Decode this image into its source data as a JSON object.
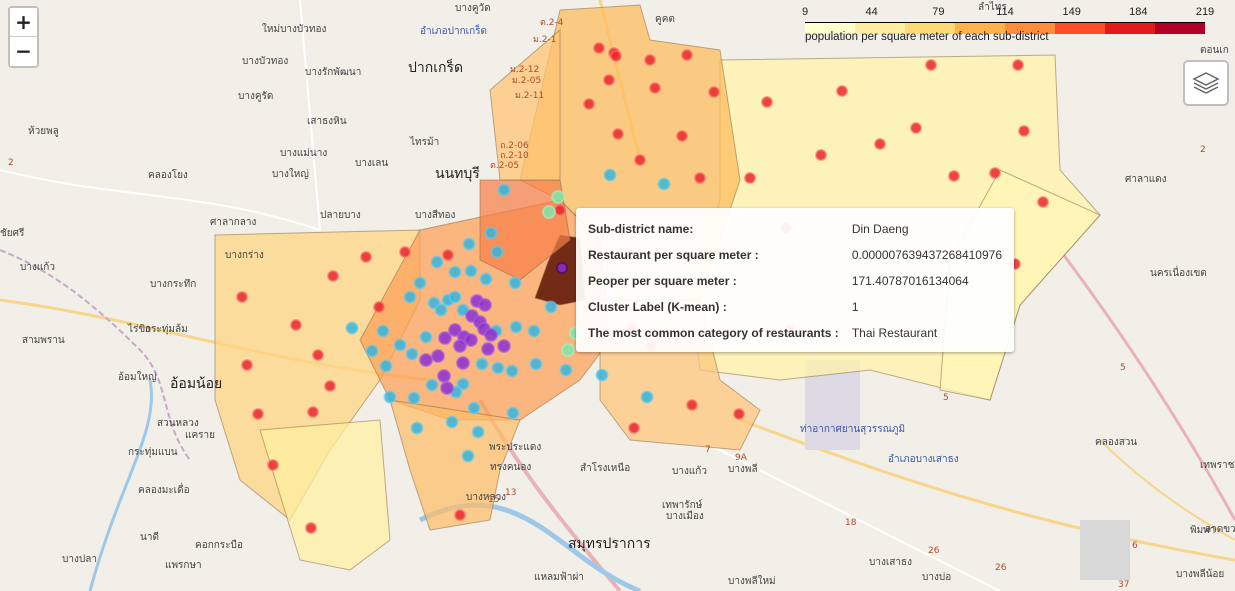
{
  "map": {
    "places": [
      {
        "text": "นนทบุรี",
        "cls": "big"
      },
      {
        "text": "ปากเกร็ด",
        "cls": "big"
      },
      {
        "text": "อ้อมน้อย",
        "cls": "big"
      },
      {
        "text": "สมุทรปราการ",
        "cls": "big"
      },
      {
        "text": "บางคูวัด",
        "cls": ""
      },
      {
        "text": "คูคต",
        "cls": ""
      },
      {
        "text": "ลำไทร",
        "cls": ""
      },
      {
        "text": "ใหม่บางบัวทอง",
        "cls": ""
      },
      {
        "text": "อำเภอปากเกร็ด",
        "cls": "blue"
      },
      {
        "text": "บางบัวทอง",
        "cls": ""
      },
      {
        "text": "บางคูรัด",
        "cls": ""
      },
      {
        "text": "บางรักพัฒนา",
        "cls": ""
      },
      {
        "text": "เสาธงหิน",
        "cls": ""
      },
      {
        "text": "ห้วยพลู",
        "cls": ""
      },
      {
        "text": "บางแม่นาง",
        "cls": ""
      },
      {
        "text": "ไทรม้า",
        "cls": ""
      },
      {
        "text": "คลองโยง",
        "cls": ""
      },
      {
        "text": "บางใหญ่",
        "cls": ""
      },
      {
        "text": "บางเลน",
        "cls": ""
      },
      {
        "text": "บางสีทอง",
        "cls": ""
      },
      {
        "text": "ปลายบาง",
        "cls": ""
      },
      {
        "text": "ศาลากลาง",
        "cls": ""
      },
      {
        "text": "บางกร่าง",
        "cls": ""
      },
      {
        "text": "ชัยศรี",
        "cls": ""
      },
      {
        "text": "ศาลาแดง",
        "cls": ""
      },
      {
        "text": "นครเนื่องเขต",
        "cls": ""
      },
      {
        "text": "ตอนเก",
        "cls": ""
      },
      {
        "text": "บางแก้ว",
        "cls": ""
      },
      {
        "text": "บางกระทึก",
        "cls": ""
      },
      {
        "text": "กระทุ่มล้ม",
        "cls": ""
      },
      {
        "text": "ไร่ขิง",
        "cls": ""
      },
      {
        "text": "สามพราน",
        "cls": ""
      },
      {
        "text": "อ้อมใหญ่",
        "cls": ""
      },
      {
        "text": "สวนหลวง",
        "cls": ""
      },
      {
        "text": "กระทุ่มแบน",
        "cls": ""
      },
      {
        "text": "แคราย",
        "cls": ""
      },
      {
        "text": "คลองมะเดื่อ",
        "cls": ""
      },
      {
        "text": "นาดี",
        "cls": ""
      },
      {
        "text": "คอกกระบือ",
        "cls": ""
      },
      {
        "text": "บางปลา",
        "cls": ""
      },
      {
        "text": "แพรกษา",
        "cls": ""
      },
      {
        "text": "แหลมฟ้าผ่า",
        "cls": ""
      },
      {
        "text": "บางพลีใหม่",
        "cls": ""
      },
      {
        "text": "บางเสาธง",
        "cls": ""
      },
      {
        "text": "บางบ่อ",
        "cls": ""
      },
      {
        "text": "บางพลีน้อย",
        "cls": ""
      },
      {
        "text": "พิมพา",
        "cls": ""
      },
      {
        "text": "ลาดขวาง",
        "cls": ""
      },
      {
        "text": "เทพราช",
        "cls": ""
      },
      {
        "text": "คลองสวน",
        "cls": ""
      },
      {
        "text": "อำเภอบางเสาธง",
        "cls": "blue"
      },
      {
        "text": "ท่าอากาศยานสุวรรณภูมิ",
        "cls": "blue"
      },
      {
        "text": "บางแก้ว",
        "cls": ""
      },
      {
        "text": "บางพลี",
        "cls": ""
      },
      {
        "text": "บางเมือง",
        "cls": ""
      },
      {
        "text": "เทพารักษ์",
        "cls": ""
      },
      {
        "text": "สำโรงเหนือ",
        "cls": ""
      },
      {
        "text": "พระประแดง",
        "cls": ""
      },
      {
        "text": "ทรงคนอง",
        "cls": ""
      },
      {
        "text": "บางหลวง",
        "cls": ""
      }
    ]
  },
  "zoom": {
    "in_label": "+",
    "out_label": "−"
  },
  "layers": {
    "icon": "layers-icon"
  },
  "legend": {
    "ticks": [
      "9",
      "44",
      "79",
      "114",
      "149",
      "184",
      "219"
    ],
    "caption": "population per square meter of each sub-district",
    "colors": [
      "#ffffcc",
      "#ffeda0",
      "#fed976",
      "#feb24c",
      "#fd8d3c",
      "#fc4e2a",
      "#e31a1c",
      "#b10026"
    ]
  },
  "tooltip": {
    "rows": [
      {
        "key": "Sub-district name:",
        "value": "Din Daeng"
      },
      {
        "key": "Restaurant per square meter :",
        "value": "0.000007639437268410976"
      },
      {
        "key": "Peoper per square meter :",
        "value": "171.40787016134064"
      },
      {
        "key": "Cluster Label (K-mean) :",
        "value": "1"
      },
      {
        "key": "The most common category of restaurants :",
        "value": "Thai Restaurant"
      }
    ]
  },
  "clusters": {
    "red": "#e8262b",
    "blue": "#36b4dc",
    "purple": "#8b2ed1",
    "green": "#7de8a8",
    "highlight": "#6b2410"
  }
}
